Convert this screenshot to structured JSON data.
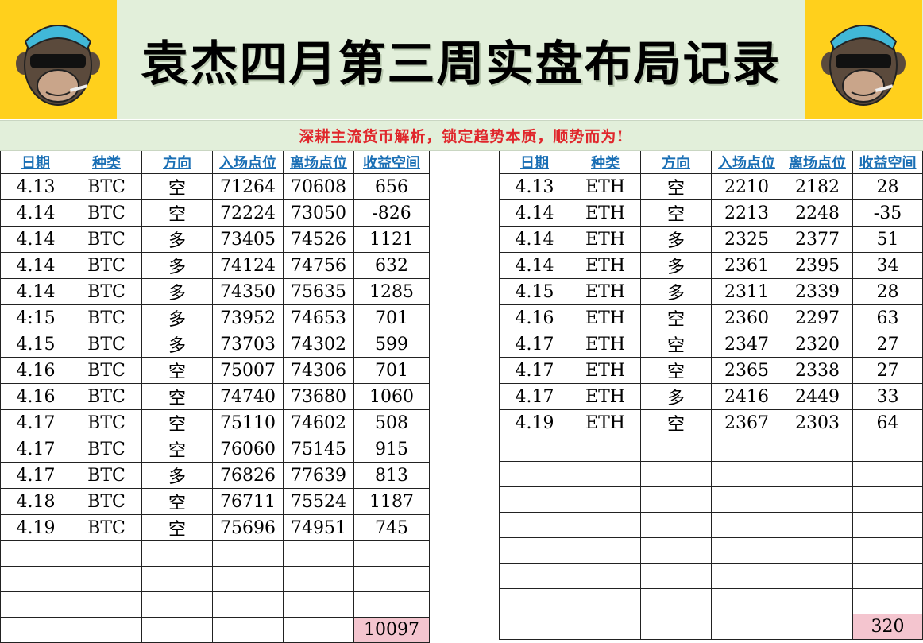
{
  "title": "袁杰四月第三周实盘布局记录",
  "subtitle": "深耕主流货币解析，锁定趋势本质，顺势而为!",
  "headers": [
    "日期",
    "种类",
    "方向",
    "入场点位",
    "离场点位",
    "收益空间"
  ],
  "colors": {
    "banner_bg": "#e2efda",
    "logo_bg": "#ffd01c",
    "header_text": "#1a6fb5",
    "positive": "#e0262b",
    "negative": "#1eaee6",
    "total_bg": "#f4c5cf"
  },
  "icons": {
    "left_logo": "monkey-sunglasses-icon",
    "right_logo": "monkey-sunglasses-icon"
  },
  "btc": {
    "rows": [
      {
        "date": "4.13",
        "type": "BTC",
        "dir": "空",
        "entry": "71264",
        "exit": "70608",
        "profit": "656"
      },
      {
        "date": "4.14",
        "type": "BTC",
        "dir": "空",
        "entry": "72224",
        "exit": "73050",
        "profit": "-826"
      },
      {
        "date": "4.14",
        "type": "BTC",
        "dir": "多",
        "entry": "73405",
        "exit": "74526",
        "profit": "1121"
      },
      {
        "date": "4.14",
        "type": "BTC",
        "dir": "多",
        "entry": "74124",
        "exit": "74756",
        "profit": "632"
      },
      {
        "date": "4.14",
        "type": "BTC",
        "dir": "多",
        "entry": "74350",
        "exit": "75635",
        "profit": "1285"
      },
      {
        "date": "4:15",
        "type": "BTC",
        "dir": "多",
        "entry": "73952",
        "exit": "74653",
        "profit": "701"
      },
      {
        "date": "4.15",
        "type": "BTC",
        "dir": "多",
        "entry": "73703",
        "exit": "74302",
        "profit": "599"
      },
      {
        "date": "4.16",
        "type": "BTC",
        "dir": "空",
        "entry": "75007",
        "exit": "74306",
        "profit": "701"
      },
      {
        "date": "4.16",
        "type": "BTC",
        "dir": "空",
        "entry": "74740",
        "exit": "73680",
        "profit": "1060"
      },
      {
        "date": "4.17",
        "type": "BTC",
        "dir": "空",
        "entry": "75110",
        "exit": "74602",
        "profit": "508"
      },
      {
        "date": "4.17",
        "type": "BTC",
        "dir": "空",
        "entry": "76060",
        "exit": "75145",
        "profit": "915"
      },
      {
        "date": "4.17",
        "type": "BTC",
        "dir": "多",
        "entry": "76826",
        "exit": "77639",
        "profit": "813"
      },
      {
        "date": "4.18",
        "type": "BTC",
        "dir": "空",
        "entry": "76711",
        "exit": "75524",
        "profit": "1187"
      },
      {
        "date": "4.19",
        "type": "BTC",
        "dir": "空",
        "entry": "75696",
        "exit": "74951",
        "profit": "745"
      }
    ],
    "total": "10097"
  },
  "eth": {
    "rows": [
      {
        "date": "4.13",
        "type": "ETH",
        "dir": "空",
        "entry": "2210",
        "exit": "2182",
        "profit": "28"
      },
      {
        "date": "4.14",
        "type": "ETH",
        "dir": "空",
        "entry": "2213",
        "exit": "2248",
        "profit": "-35"
      },
      {
        "date": "4.14",
        "type": "ETH",
        "dir": "多",
        "entry": "2325",
        "exit": "2377",
        "profit": "51"
      },
      {
        "date": "4.14",
        "type": "ETH",
        "dir": "多",
        "entry": "2361",
        "exit": "2395",
        "profit": "34"
      },
      {
        "date": "4.15",
        "type": "ETH",
        "dir": "多",
        "entry": "2311",
        "exit": "2339",
        "profit": "28"
      },
      {
        "date": "4.16",
        "type": "ETH",
        "dir": "空",
        "entry": "2360",
        "exit": "2297",
        "profit": "63"
      },
      {
        "date": "4.17",
        "type": "ETH",
        "dir": "空",
        "entry": "2347",
        "exit": "2320",
        "profit": "27"
      },
      {
        "date": "4.17",
        "type": "ETH",
        "dir": "空",
        "entry": "2365",
        "exit": "2338",
        "profit": "27"
      },
      {
        "date": "4.17",
        "type": "ETH",
        "dir": "多",
        "entry": "2416",
        "exit": "2449",
        "profit": "33"
      },
      {
        "date": "4.19",
        "type": "ETH",
        "dir": "空",
        "entry": "2367",
        "exit": "2303",
        "profit": "64"
      }
    ],
    "total": "320"
  }
}
